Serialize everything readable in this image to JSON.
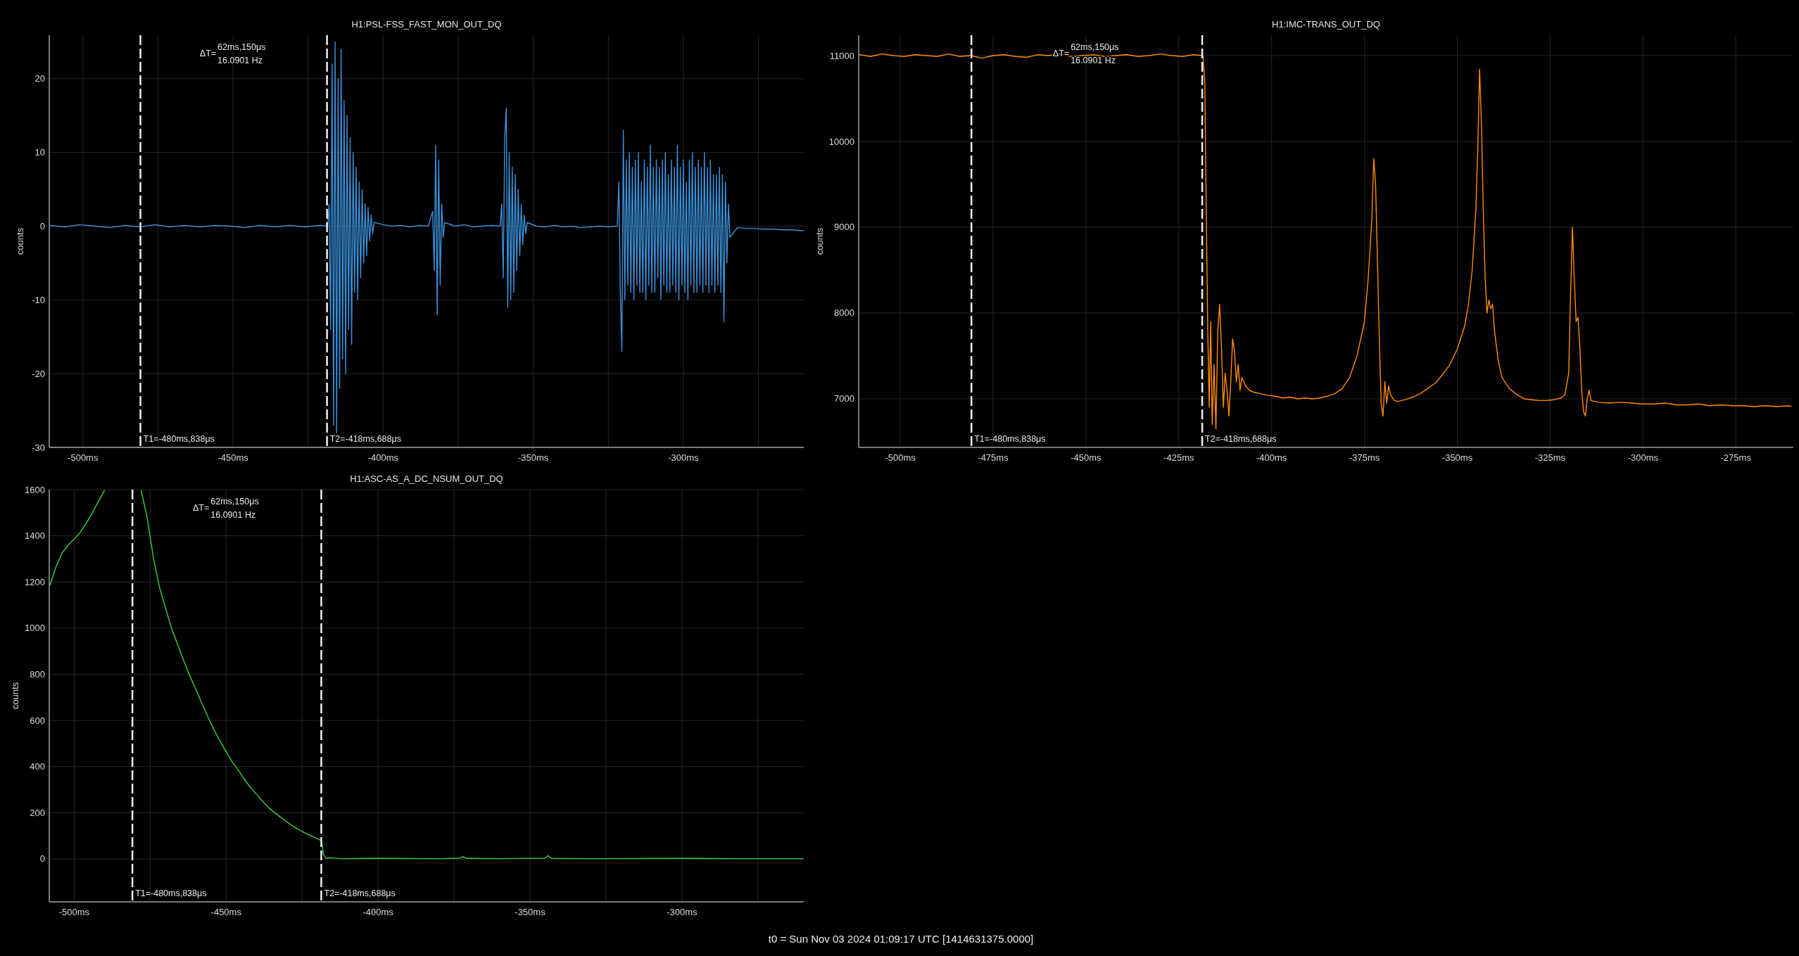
{
  "plots": [
    {
      "chart_data": {
        "type": "line",
        "title": "H1:PSL-FSS_FAST_MON_OUT_DQ",
        "ylabel": "counts",
        "grid": true,
        "xlim": [
          -511.2,
          -259.9
        ],
        "ylim": [
          -30,
          25.9
        ],
        "xticks": [
          {
            "value": -500,
            "label": "-500ms"
          },
          {
            "value": -450,
            "label": "-450ms"
          },
          {
            "value": -400,
            "label": "-400ms"
          },
          {
            "value": -350,
            "label": "-350ms"
          },
          {
            "value": -300,
            "label": "-300ms"
          }
        ],
        "yticks": [
          20,
          10,
          0,
          -10,
          -20,
          -30
        ],
        "x": [
          -511,
          -506,
          -501,
          -496,
          -491,
          -486,
          -481,
          -476,
          -471,
          -466,
          -461,
          -456,
          -451,
          -446,
          -441,
          -436,
          -431,
          -426,
          -421,
          -418.5,
          -418,
          -417.5,
          -417,
          -416.5,
          -416,
          -415.5,
          -415,
          -414.5,
          -414,
          -413.5,
          -413,
          -412.5,
          -412,
          -411.5,
          -411,
          -410.5,
          -410,
          -409.5,
          -409,
          -408.5,
          -408,
          -407.5,
          -407,
          -406.5,
          -406,
          -405.5,
          -405,
          -404.5,
          -404,
          -403.5,
          -403,
          -400,
          -397,
          -394,
          -391,
          -388,
          -385,
          -383.5,
          -383,
          -382.5,
          -382,
          -381.5,
          -381,
          -380.5,
          -380,
          -379.5,
          -376,
          -373,
          -370,
          -367,
          -364,
          -361,
          -360.5,
          -360,
          -359.5,
          -359,
          -358.5,
          -358,
          -357.5,
          -357,
          -356.5,
          -356,
          -355.5,
          -355,
          -354.5,
          -354,
          -353.5,
          -353,
          -352.5,
          -352,
          -349,
          -346,
          -343,
          -340,
          -337,
          -334,
          -331,
          -328,
          -325,
          -322,
          -321.5,
          -321,
          -320.5,
          -320,
          -319.5,
          -319,
          -318.5,
          -318,
          -317.5,
          -317,
          -316.5,
          -316,
          -315.5,
          -315,
          -314.5,
          -314,
          -313.5,
          -313,
          -312.5,
          -312,
          -311.5,
          -311,
          -310.5,
          -310,
          -309.5,
          -309,
          -308.5,
          -308,
          -307.5,
          -307,
          -306.5,
          -306,
          -305.5,
          -305,
          -304.5,
          -304,
          -303.5,
          -303,
          -302.5,
          -302,
          -301.5,
          -301,
          -300.5,
          -300,
          -299.5,
          -299,
          -298.5,
          -298,
          -297.5,
          -297,
          -296.5,
          -296,
          -295.5,
          -295,
          -294.5,
          -294,
          -293.5,
          -293,
          -292.5,
          -292,
          -291.5,
          -291,
          -290.5,
          -290,
          -289.5,
          -289,
          -288.5,
          -288,
          -287.5,
          -287,
          -286.5,
          -286,
          -285.5,
          -285,
          -284.5,
          -282,
          -279,
          -276,
          -273,
          -270,
          -267,
          -264,
          -261,
          -260
        ],
        "series": [
          {
            "color": "#3a8fd8",
            "values": [
              0.1,
              -0.1,
              0.2,
              0,
              -0.2,
              0.1,
              -0.1,
              0.2,
              -0.1,
              0.1,
              -0.1,
              0.1,
              0,
              -0.2,
              0.1,
              -0.1,
              0.1,
              -0.1,
              0.1,
              0,
              3,
              -14,
              22,
              -27,
              25,
              -28,
              20,
              -22,
              24,
              -18,
              17,
              -20,
              15,
              -14,
              12,
              -16,
              10,
              -9,
              8,
              -10,
              6,
              -7,
              5,
              -5,
              3,
              -4,
              2.5,
              -2,
              1.5,
              -1,
              0.5,
              0.2,
              0,
              0.1,
              -0.1,
              0.1,
              0,
              2,
              -6,
              11,
              -12,
              9,
              -8,
              3,
              -1.5,
              0.5,
              0,
              0.2,
              -0.1,
              0,
              0.1,
              0,
              3,
              -7,
              12,
              16,
              -11,
              10,
              -10,
              8,
              -9,
              7,
              -6,
              5,
              -4,
              3,
              -2.5,
              1.5,
              -1,
              0.5,
              0,
              -0.1,
              0.1,
              -0.1,
              0,
              -0.2,
              -0.1,
              0,
              -0.1,
              0,
              6,
              -9,
              -17,
              13,
              -10,
              9,
              -8,
              10,
              -9,
              8,
              -10,
              9,
              -8,
              10,
              -9,
              6,
              -9,
              9,
              -10,
              8,
              -8,
              11,
              -9,
              8,
              -9,
              9,
              -7,
              8,
              -10,
              9,
              -8,
              10,
              -9,
              7,
              -9,
              9,
              -8,
              8,
              -9,
              11,
              -10,
              8,
              -8,
              9,
              -9,
              6,
              -10,
              9,
              -8,
              10,
              -9,
              8,
              -9,
              9,
              -8,
              8,
              -9,
              10,
              -8,
              8,
              -9,
              9,
              -8,
              7,
              -9,
              7,
              -8,
              8,
              -9,
              7,
              -13,
              6,
              -5,
              3,
              -1.5,
              -0.2,
              -0.3,
              -0.3,
              -0.4,
              -0.4,
              -0.5,
              -0.5,
              -0.6,
              -0.6
            ]
          }
        ],
        "ref_lines": [
          {
            "axis": "x",
            "value": -480.838
          },
          {
            "axis": "x",
            "value": -418.688
          }
        ]
      },
      "cursor_labels": [
        "T1=-480ms,838μs",
        "T2=-418ms,688μs"
      ],
      "cursor_delta": {
        "label": "ΔT=",
        "time": "62ms,150μs",
        "frequency": "16.0901 Hz"
      }
    },
    {
      "chart_data": {
        "type": "line",
        "title": "H1:IMC-TRANS_OUT_DQ",
        "ylabel": "counts",
        "grid": true,
        "xlim": [
          -511.2,
          -259.5
        ],
        "ylim": [
          6434,
          11238
        ],
        "xticks": [
          {
            "value": -500,
            "label": "-500ms"
          },
          {
            "value": -475,
            "label": "-475ms"
          },
          {
            "value": -450,
            "label": "-450ms"
          },
          {
            "value": -425,
            "label": "-425ms"
          },
          {
            "value": -400,
            "label": "-400ms"
          },
          {
            "value": -375,
            "label": "-375ms"
          },
          {
            "value": -350,
            "label": "-350ms"
          },
          {
            "value": -325,
            "label": "-325ms"
          },
          {
            "value": -300,
            "label": "-300ms"
          },
          {
            "value": -275,
            "label": "-275ms"
          }
        ],
        "yticks": [
          11000,
          10000,
          9000,
          8000,
          7000
        ],
        "x": [
          -511,
          -508,
          -505,
          -502,
          -499,
          -496,
          -493,
          -490,
          -487,
          -484,
          -481,
          -478,
          -475,
          -472,
          -469,
          -466,
          -463,
          -460,
          -457,
          -454,
          -451,
          -448,
          -445,
          -442,
          -439,
          -436,
          -433,
          -430,
          -427,
          -424,
          -421,
          -418.5,
          -418,
          -417.6,
          -417.2,
          -416.8,
          -416.4,
          -416,
          -415.5,
          -415,
          -414.5,
          -414,
          -413.5,
          -413,
          -412.5,
          -412,
          -411.5,
          -411,
          -410.5,
          -410,
          -409.5,
          -409,
          -408.5,
          -408,
          -407,
          -406,
          -405,
          -403,
          -401,
          -399,
          -397,
          -395,
          -393,
          -391,
          -389,
          -387,
          -385,
          -383,
          -381,
          -379,
          -377,
          -375,
          -374,
          -373,
          -372.5,
          -372,
          -371.5,
          -371,
          -370.5,
          -370,
          -369.5,
          -369,
          -368.5,
          -368,
          -367,
          -366,
          -364,
          -362,
          -360,
          -358,
          -356,
          -354,
          -352,
          -350,
          -348,
          -347,
          -346,
          -345,
          -344.5,
          -344,
          -343.5,
          -343,
          -342.5,
          -342,
          -341.5,
          -341,
          -340.5,
          -340,
          -339,
          -338,
          -336,
          -334,
          -332,
          -330,
          -328,
          -326,
          -324,
          -322,
          -321,
          -320,
          -319.5,
          -319,
          -318.5,
          -318,
          -317.5,
          -317,
          -316.5,
          -316,
          -315.5,
          -315,
          -314.5,
          -314,
          -312,
          -309,
          -306,
          -303,
          -300,
          -297,
          -294,
          -291,
          -288,
          -285,
          -282,
          -279,
          -276,
          -273,
          -270,
          -267,
          -264,
          -261,
          -260
        ],
        "series": [
          {
            "color": "#ff8c00",
            "values": [
              11010,
              10990,
              11020,
              11000,
              10990,
              11010,
              11000,
              10990,
              11020,
              10990,
              11000,
              10970,
              11000,
              11010,
              10990,
              10980,
              11010,
              11000,
              11020,
              10990,
              11000,
              11010,
              10990,
              11000,
              11010,
              10990,
              11000,
              11020,
              11000,
              10990,
              11010,
              11000,
              10700,
              9200,
              7800,
              6900,
              7900,
              6700,
              7400,
              6650,
              7800,
              8100,
              7600,
              6900,
              7300,
              7100,
              6800,
              7200,
              7700,
              7550,
              7200,
              7400,
              7100,
              7250,
              7150,
              7100,
              7080,
              7060,
              7040,
              7030,
              7010,
              7020,
              7000,
              7010,
              7000,
              7010,
              7030,
              7060,
              7120,
              7250,
              7500,
              7900,
              8400,
              9100,
              9800,
              9500,
              8600,
              7700,
              6950,
              6800,
              7200,
              6950,
              7150,
              7050,
              6980,
              6970,
              6990,
              7020,
              7060,
              7120,
              7180,
              7280,
              7400,
              7580,
              7850,
              8100,
              8500,
              9200,
              9900,
              10840,
              10200,
              9200,
              8400,
              8000,
              8150,
              8050,
              8100,
              7800,
              7450,
              7250,
              7120,
              7050,
              7000,
              6990,
              6980,
              6980,
              6990,
              7010,
              7050,
              7300,
              8200,
              9000,
              8400,
              7900,
              7950,
              7600,
              7100,
              6850,
              6800,
              7000,
              7100,
              6980,
              6960,
              6950,
              6960,
              6950,
              6940,
              6940,
              6950,
              6930,
              6930,
              6940,
              6920,
              6930,
              6920,
              6920,
              6910,
              6920,
              6910,
              6920,
              6910
            ]
          }
        ],
        "ref_lines": [
          {
            "axis": "x",
            "value": -480.838
          },
          {
            "axis": "x",
            "value": -418.688
          }
        ]
      },
      "cursor_labels": [
        "T1=-480ms,838μs",
        "T2=-418ms,688μs"
      ],
      "cursor_delta": {
        "label": "ΔT=",
        "time": "62ms,150μs",
        "frequency": "16.0901 Hz"
      }
    },
    {
      "chart_data": {
        "type": "line",
        "title": "H1:ASC-AS_A_DC_NSUM_OUT_DQ",
        "ylabel": "counts",
        "grid": true,
        "xlim": [
          -508.2,
          -259.9
        ],
        "ylim": [
          -186,
          1600
        ],
        "xticks": [
          {
            "value": -500,
            "label": "-500ms"
          },
          {
            "value": -450,
            "label": "-450ms"
          },
          {
            "value": -400,
            "label": "-400ms"
          },
          {
            "value": -350,
            "label": "-350ms"
          },
          {
            "value": -300,
            "label": "-300ms"
          }
        ],
        "yticks": [
          1600,
          1400,
          1200,
          1000,
          800,
          600,
          400,
          200,
          0
        ],
        "x": [
          -508,
          -506,
          -504,
          -502,
          -500,
          -498,
          -496,
          -494,
          -492,
          -490,
          -488,
          -486,
          -484,
          -482,
          -480,
          -478,
          -476,
          -474,
          -472,
          -470,
          -468,
          -466,
          -464,
          -462,
          -460,
          -458,
          -456,
          -454,
          -452,
          -450,
          -448,
          -446,
          -444,
          -442,
          -440,
          -438,
          -436,
          -434,
          -432,
          -430,
          -428,
          -426,
          -424,
          -422,
          -420,
          -418.6,
          -418,
          -417,
          -416,
          -412,
          -400,
          -380,
          -373,
          -372,
          -371,
          -360,
          -345,
          -344,
          -343,
          -330,
          -300,
          -280,
          -260
        ],
        "series": [
          {
            "color": "#3ccf3c",
            "values": [
              1185,
              1265,
              1325,
              1360,
              1385,
              1415,
              1455,
              1500,
              1550,
              1598,
              null,
              null,
              null,
              null,
              null,
              1598,
              1480,
              1310,
              1180,
              1090,
              1000,
              930,
              860,
              795,
              735,
              675,
              615,
              560,
              510,
              465,
              420,
              385,
              345,
              310,
              280,
              250,
              222,
              200,
              180,
              160,
              142,
              126,
              112,
              100,
              88,
              78,
              20,
              2,
              5,
              1,
              2,
              1,
              3,
              10,
              2,
              1,
              3,
              14,
              2,
              1,
              2,
              1,
              1
            ]
          }
        ],
        "ref_lines": [
          {
            "axis": "x",
            "value": -480.838
          },
          {
            "axis": "x",
            "value": -418.688
          }
        ]
      },
      "cursor_labels": [
        "T1=-480ms,838μs",
        "T2=-418ms,688μs"
      ],
      "cursor_delta": {
        "label": "ΔT=",
        "time": "62ms,150μs",
        "frequency": "16.0901 Hz"
      }
    }
  ],
  "footer": {
    "text": "t0 = Sun Nov 03 2024 01:09:17 UTC [1414631375.0000]"
  }
}
